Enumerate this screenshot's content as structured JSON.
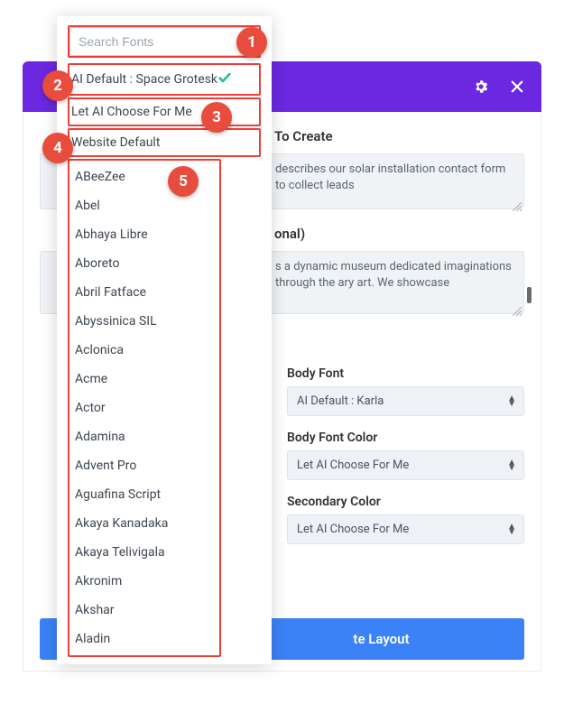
{
  "dropdown": {
    "search_placeholder": "Search Fonts",
    "special": {
      "ai_default": "AI Default : Space Grotesk",
      "let_ai": "Let AI Choose For Me",
      "site_default": "Website Default"
    },
    "fonts": [
      "ABeeZee",
      "Abel",
      "Abhaya Libre",
      "Aboreto",
      "Abril Fatface",
      "Abyssinica SIL",
      "Aclonica",
      "Acme",
      "Actor",
      "Adamina",
      "Advent Pro",
      "Aguafina Script",
      "Akaya Kanadaka",
      "Akaya Telivigala",
      "Akronim",
      "Akshar",
      "Aladin"
    ]
  },
  "modal": {
    "section_create": "To Create",
    "create_text": "describes our solar installation contact form to collect leads",
    "section_optional": "onal)",
    "optional_text": "s a dynamic museum dedicated imaginations through the ary art. We showcase",
    "body_font_label": "Body Font",
    "body_font_value": "AI Default : Karla",
    "body_color_label": "Body Font Color",
    "body_color_value": "Let AI Choose For Me",
    "secondary_color_label": "Secondary Color",
    "secondary_color_value": "Let AI Choose For Me",
    "generate_btn": "te Layout"
  },
  "annotations": [
    "1",
    "2",
    "3",
    "4",
    "5"
  ]
}
